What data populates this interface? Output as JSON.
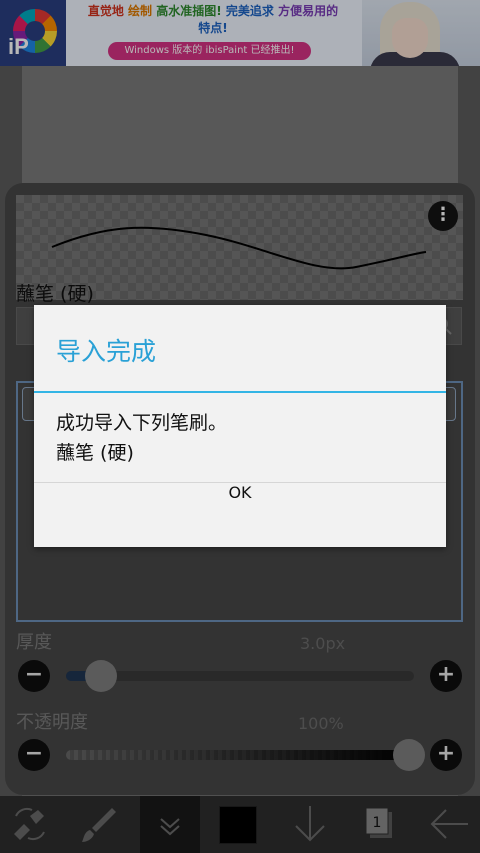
{
  "ad": {
    "line1_a": "直觉地",
    "line1_b": "绘制",
    "line1_c": "高水准插图!",
    "line1_d": "完美追求",
    "line1_e": "方便易用的",
    "line2": "特点!",
    "pill": "Windows 版本的 ibisPaint 已经推出!"
  },
  "brush_panel": {
    "brush_name": "蘸笔 (硬)",
    "thickness_label": "厚度",
    "thickness_value": "3.0px",
    "thickness_level": 0.08,
    "opacity_label": "不透明度",
    "opacity_value": "100%",
    "opacity_level": 1.0
  },
  "dialog": {
    "title": "导入完成",
    "message_line1": "成功导入下列笔刷。",
    "message_line2": "蘸笔 (硬)",
    "ok_label": "OK"
  },
  "toolbar": {
    "layer_count": "1"
  },
  "colors": {
    "accent": "#33b5e5",
    "selected_color": "#000000"
  }
}
